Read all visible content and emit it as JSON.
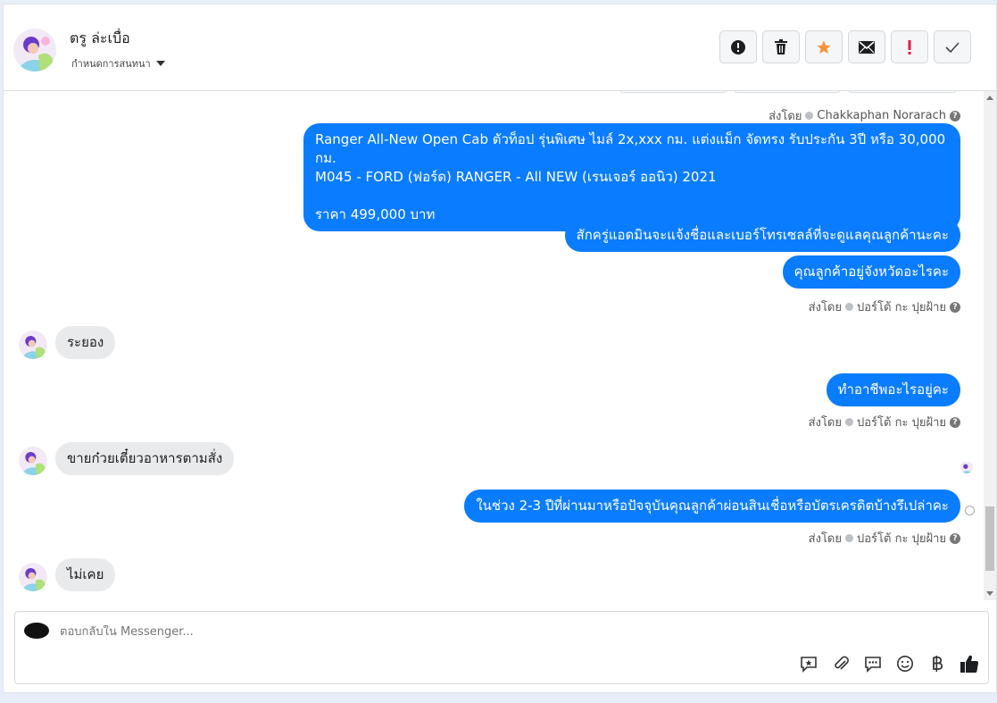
{
  "header": {
    "name": "ตรู ล่ะเบื่อ",
    "subtitle": "กำหนดการสนทนา"
  },
  "colors": {
    "accent": "#0a7cff",
    "star": "#f7923a",
    "danger": "#e41e3f"
  },
  "messages": [
    {
      "sender_label": "ส่งโดย",
      "sender": "Chakkaphan Norarach"
    },
    {
      "text": "Ranger All-New Open Cab ตัวท็อป รุ่นพิเศษ ไมล์ 2x,xxx กม. แต่งแม็ก จัดทรง รับประกัน 3ปี หรือ 30,000 กม.\nM045 - FORD (ฟอร์ด) RANGER - All NEW (เรนเจอร์ ออนิว) 2021\n\nราคา 499,000 บาท"
    },
    {
      "text": "สักครู่แอดมินจะแจ้งชื่อและเบอร์โทรเซลล์ที่จะดูแลคุณลูกค้านะคะ"
    },
    {
      "text": "คุณลูกค้าอยู่จังหวัดอะไรคะ"
    },
    {
      "sender_label": "ส่งโดย",
      "sender": "ปอร์โต้ กะ ปุยฝ้าย"
    },
    {
      "text": "ระยอง"
    },
    {
      "text": "ทำอาชีพอะไรอยู่คะ"
    },
    {
      "sender_label": "ส่งโดย",
      "sender": "ปอร์โต้ กะ ปุยฝ้าย"
    },
    {
      "text": "ขายก๋วยเตี๋ยวอาหารตามสั่ง"
    },
    {
      "text": "ในช่วง 2-3 ปีที่ผ่านมาหรือปัจจุบันคุณลูกค้าผ่อนสินเชื่อหรือบัตรเครดิตบ้างรึเปล่าคะ"
    },
    {
      "sender_label": "ส่งโดย",
      "sender": "ปอร์โต้ กะ ปุยฝ้าย"
    },
    {
      "text": "ไม่เคย"
    }
  ],
  "composer": {
    "placeholder": "ตอบกลับใน Messenger..."
  }
}
